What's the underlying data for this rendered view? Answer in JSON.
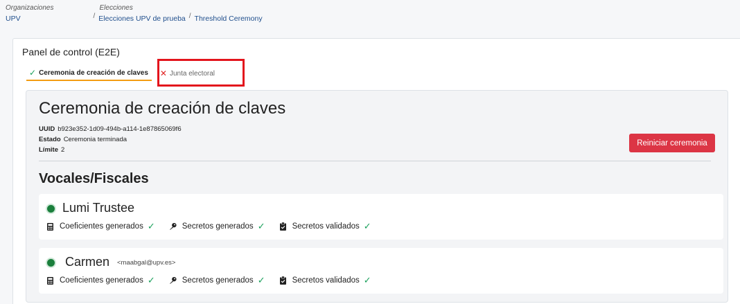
{
  "breadcrumbs": {
    "org_header": "Organizaciones",
    "org_value": "UPV",
    "elections_header": "Elecciones",
    "path": [
      "Elecciones UPV de prueba",
      "Threshold Ceremony"
    ],
    "separator": "/"
  },
  "panel": {
    "title": "Panel de control (E2E)",
    "tabs": [
      {
        "label": "Ceremonia de creación de claves",
        "status": "done",
        "active": true
      },
      {
        "label": "Junta electoral",
        "status": "error",
        "active": false
      }
    ]
  },
  "ceremony": {
    "title": "Ceremonia de creación de claves",
    "uuid_label": "UUID",
    "uuid_value": "b923e352-1d09-494b-a114-1e87865069f6",
    "status_label": "Estado",
    "status_value": "Ceremonia terminada",
    "limit_label": "Límite",
    "limit_value": "2",
    "reset_button": "Reiniciar ceremonia"
  },
  "trustees_section": {
    "title": "Vocales/Fiscales",
    "trustees": [
      {
        "name": "Lumi Trustee",
        "email": ""
      },
      {
        "name": "Carmen",
        "email": "<maabgal@upv.es>"
      }
    ],
    "steps": [
      "Coeficientes generados",
      "Secretos generados",
      "Secretos validados"
    ]
  },
  "colors": {
    "accent_tab": "#f39c12",
    "success": "#18a05a",
    "danger": "#dc3545",
    "status_dot": "#1a7f3c",
    "highlight": "#e3141c"
  }
}
